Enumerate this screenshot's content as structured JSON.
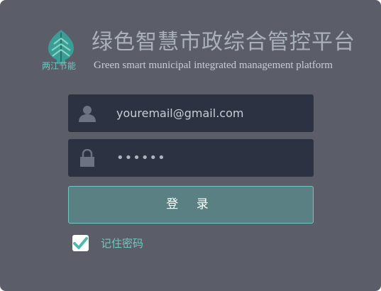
{
  "header": {
    "logo_caption": "两江节能",
    "title_cn": "绿色智慧市政综合管控平台",
    "title_en": "Green smart municipal integrated management platform"
  },
  "form": {
    "email": {
      "value": "youremail@gmail.com",
      "icon": "user-icon"
    },
    "password": {
      "value": "••••••",
      "icon": "lock-icon"
    },
    "login_label": "登 录",
    "remember": {
      "label": "记住密码",
      "checked": true
    }
  },
  "colors": {
    "panel_bg": "#5b5e68",
    "field_bg": "#2c3241",
    "accent": "#6fc8c0",
    "button_bg": "#5b8083"
  }
}
